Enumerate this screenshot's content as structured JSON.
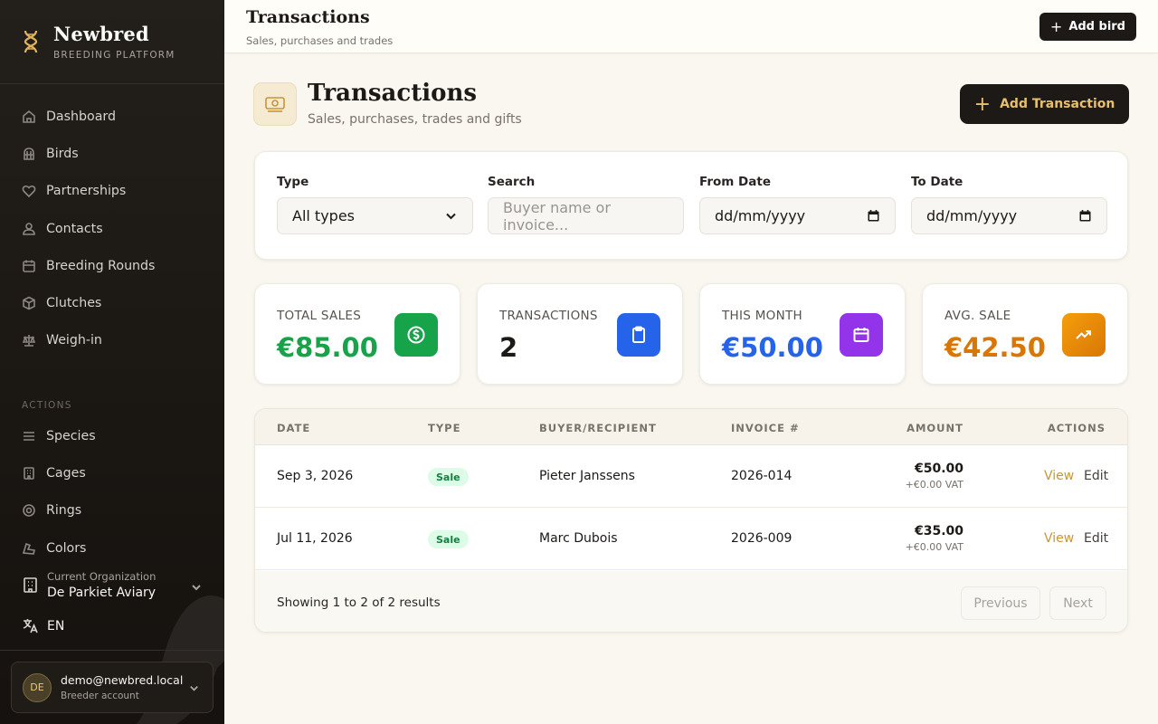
{
  "brand": {
    "name": "Newbred",
    "tagline": "BREEDING PLATFORM"
  },
  "nav": [
    {
      "label": "Dashboard",
      "icon": "home-icon"
    },
    {
      "label": "Birds",
      "icon": "bird-cage-icon"
    },
    {
      "label": "Partnerships",
      "icon": "heart-icon"
    },
    {
      "label": "Contacts",
      "icon": "users-icon"
    },
    {
      "label": "Breeding Rounds",
      "icon": "calendar-icon"
    },
    {
      "label": "Clutches",
      "icon": "box-icon"
    },
    {
      "label": "Weigh-in",
      "icon": "scale-icon"
    }
  ],
  "actions_label": "ACTIONS",
  "actions_nav": [
    {
      "label": "Species",
      "icon": "list-icon"
    },
    {
      "label": "Cages",
      "icon": "building-icon"
    },
    {
      "label": "Rings",
      "icon": "ring-icon"
    },
    {
      "label": "Colors",
      "icon": "palette-icon"
    }
  ],
  "organization": {
    "label": "Current Organization",
    "name": "De Parkiet Aviary"
  },
  "language": "EN",
  "user": {
    "initials": "DE",
    "email": "demo@newbred.local",
    "role": "Breeder account"
  },
  "topbar": {
    "title": "Transactions",
    "subtitle": "Sales, purchases and trades",
    "add_bird_label": "Add bird"
  },
  "page": {
    "title": "Transactions",
    "subtitle": "Sales, purchases, trades and gifts",
    "add_label": "Add Transaction"
  },
  "filters": {
    "type_label": "Type",
    "type_value": "All types",
    "search_label": "Search",
    "search_placeholder": "Buyer name or invoice...",
    "from_label": "From Date",
    "from_placeholder": "dd/mm/yyyy",
    "to_label": "To Date",
    "to_placeholder": "dd/mm/yyyy"
  },
  "stats": [
    {
      "label": "TOTAL SALES",
      "value": "€85.00",
      "color": "#16a34a",
      "icon": "dollar-icon",
      "icon_bg": "#16a34a"
    },
    {
      "label": "TRANSACTIONS",
      "value": "2",
      "color": "#1c1917",
      "icon": "clipboard-icon",
      "icon_bg": "#2563eb"
    },
    {
      "label": "THIS MONTH",
      "value": "€50.00",
      "color": "#2563eb",
      "icon": "calendar-icon",
      "icon_bg": "#9333ea"
    },
    {
      "label": "AVG. SALE",
      "value": "€42.50",
      "color": "#d97706",
      "icon": "trending-up-icon",
      "icon_bg": "#e38b0c"
    }
  ],
  "table": {
    "headers": {
      "date": "DATE",
      "type": "TYPE",
      "buyer": "BUYER/RECIPIENT",
      "invoice": "INVOICE #",
      "amount": "AMOUNT",
      "actions": "ACTIONS"
    },
    "rows": [
      {
        "date": "Sep 3, 2026",
        "type": "Sale",
        "buyer": "Pieter Janssens",
        "invoice": "2026-014",
        "amount": "€50.00",
        "vat": "+€0.00 VAT",
        "view": "View",
        "edit": "Edit"
      },
      {
        "date": "Jul 11, 2026",
        "type": "Sale",
        "buyer": "Marc Dubois",
        "invoice": "2026-009",
        "amount": "€35.00",
        "vat": "+€0.00 VAT",
        "view": "View",
        "edit": "Edit"
      }
    ],
    "showing": "Showing 1 to 2 of 2 results",
    "previous": "Previous",
    "next": "Next"
  }
}
